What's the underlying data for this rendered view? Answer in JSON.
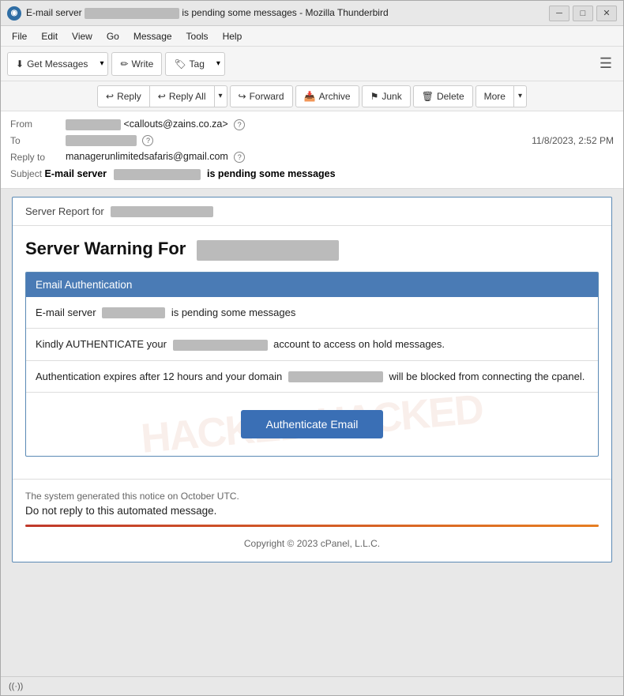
{
  "window": {
    "title": "E-mail server [redacted] is pending some messages - Mozilla Thunderbird",
    "title_short": "E-mail server",
    "title_mid": "[redacted]",
    "title_end": "is pending some messages - Mozilla Thunderbird"
  },
  "menu": {
    "items": [
      "File",
      "Edit",
      "View",
      "Go",
      "Message",
      "Tools",
      "Help"
    ]
  },
  "toolbar": {
    "get_messages": "Get Messages",
    "write": "Write",
    "tag": "Tag",
    "hamburger": "☰"
  },
  "actions": {
    "reply": "Reply",
    "reply_all": "Reply All",
    "forward": "Forward",
    "archive": "Archive",
    "junk": "Junk",
    "delete": "Delete",
    "more": "More"
  },
  "email_header": {
    "from_label": "From",
    "from_name": "[redacted]",
    "from_email": "<callouts@zains.co.za>",
    "to_label": "To",
    "to_value": "[redacted]",
    "date": "11/8/2023, 2:52 PM",
    "reply_to_label": "Reply to",
    "reply_to_value": "managerunlimitedsafaris@gmail.com",
    "subject_label": "Subject",
    "subject_prefix": "E-mail server",
    "subject_blurred": "[redacted]",
    "subject_suffix": "is pending some messages"
  },
  "email_body": {
    "server_report_prefix": "Server Report for",
    "server_report_domain": "[redacted]",
    "warning_title_prefix": "Server Warning For",
    "warning_title_domain": "[redacted]",
    "auth_section_header": "Email Authentication",
    "row1_prefix": "E-mail server",
    "row1_blurred": "[redacted]",
    "row1_suffix": "is pending some messages",
    "row2_prefix": "Kindly AUTHENTICATE your",
    "row2_blurred": "[redacted]",
    "row2_suffix": "account to access on hold messages.",
    "row3_prefix": "Authentication expires after 12 hours  and your domain",
    "row3_blurred": "[redacted]",
    "row3_suffix": "will be blocked from connecting the cpanel.",
    "auth_button": "Authenticate Email",
    "watermark": "HACKED HACKED",
    "footer_notice": "The system generated this notice on October UTC.",
    "footer_main": "Do not reply to this automated message.",
    "footer_copyright": "Copyright © 2023 cPanel, L.L.C."
  },
  "status_bar": {
    "wifi_icon": "((·))"
  },
  "icons": {
    "reply": "↩",
    "reply_all": "↩↩",
    "forward": "↪",
    "archive": "📥",
    "junk": "⚑",
    "delete": "🗑",
    "dropdown": "▾",
    "get_messages": "⬇",
    "write": "✏",
    "tag": "🏷",
    "minimize": "─",
    "maximize": "□",
    "close": "✕",
    "thunderbird": "◉",
    "privacy": "?"
  }
}
